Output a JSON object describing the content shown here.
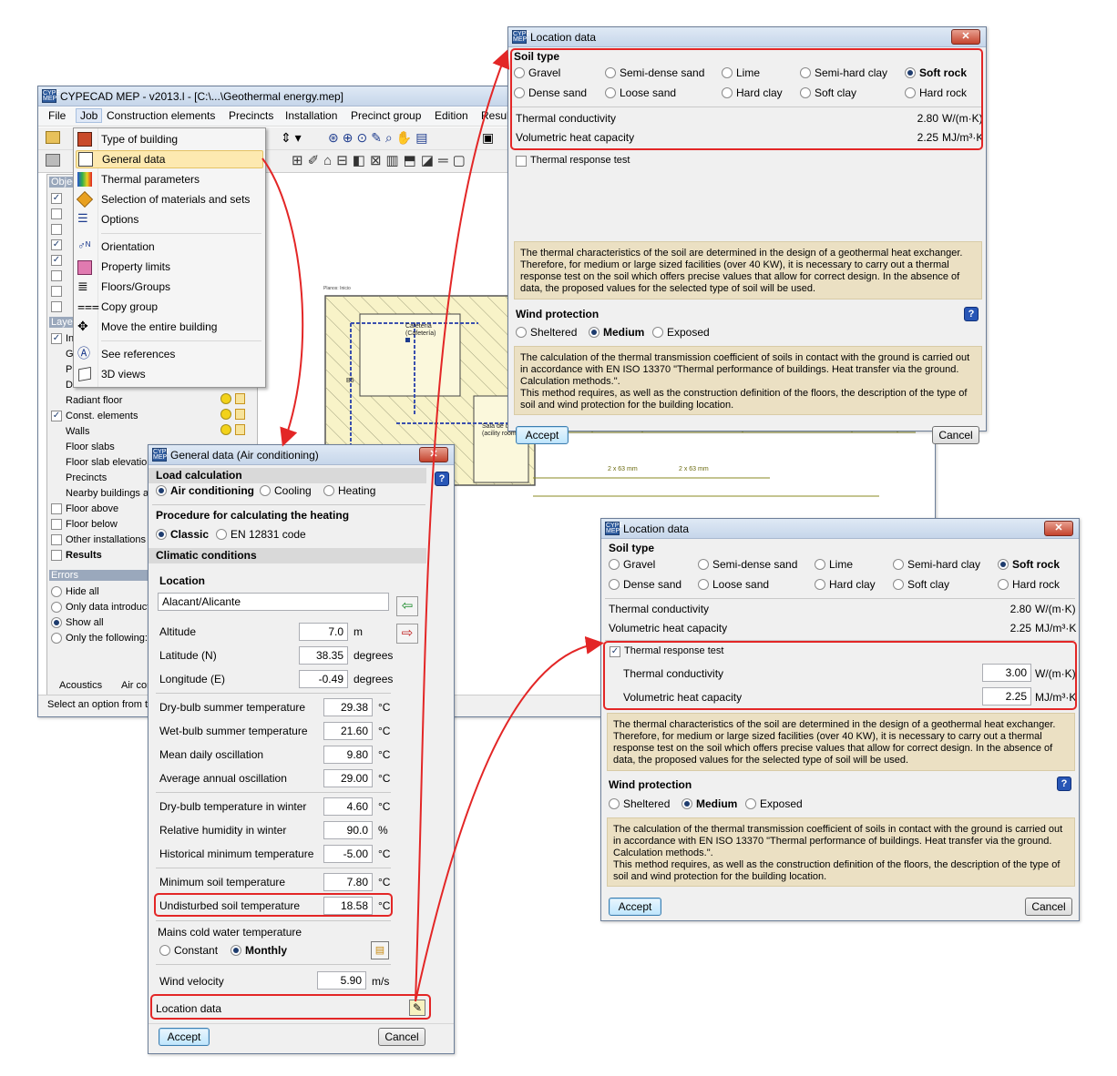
{
  "main_window": {
    "title": "CYPECAD MEP - v2013.l - [C:\\...\\Geothermal energy.mep]",
    "menu": [
      "File",
      "Job",
      "Construction elements",
      "Precincts",
      "Installation",
      "Precinct group",
      "Edition",
      "Resul"
    ],
    "panel": {
      "objects_header": "Objec",
      "layers_header": "Laye",
      "layer_rows": [
        {
          "label": "Ins",
          "checked": true
        },
        {
          "label": "Gr",
          "checked": null
        },
        {
          "label": "Pi",
          "checked": null
        },
        {
          "label": "Ducts",
          "checked": null
        },
        {
          "label": "Radiant floor",
          "checked": null
        },
        {
          "label": "Const. elements",
          "checked": true
        },
        {
          "label": "Walls",
          "checked": null
        },
        {
          "label": "Floor slabs",
          "checked": null
        },
        {
          "label": "Floor slab elevation",
          "checked": null
        },
        {
          "label": "Precincts",
          "checked": null
        },
        {
          "label": "Nearby buildings ar",
          "checked": null
        },
        {
          "label": "Floor above",
          "checked": false
        },
        {
          "label": "Floor below",
          "checked": false
        },
        {
          "label": "Other installations",
          "checked": false
        },
        {
          "label": "Results",
          "checked": false
        }
      ],
      "errors_header": "Errors",
      "error_options": [
        "Hide all",
        "Only data introducti",
        "Show all",
        "Only the following:"
      ],
      "error_selected": 2
    },
    "tabs": [
      "Acoustics",
      "Air con"
    ],
    "status": "Select an option from th",
    "drawing_labels": [
      "Cafetería",
      "(Cafetería)",
      "Sala de ca",
      "(acility room)",
      "B5",
      "2 x 63 mm",
      "2 x 63 mm",
      "Planos: Inicio"
    ]
  },
  "job_menu": {
    "items": [
      "Type of building",
      "General data",
      "Thermal parameters",
      "Selection of materials and sets",
      "Options",
      "Orientation",
      "Property limits",
      "Floors/Groups",
      "Copy group",
      "Move the entire building",
      "See references",
      "3D views"
    ],
    "highlighted": "General data"
  },
  "general_data": {
    "title": "General data (Air conditioning)",
    "load_calculation": {
      "header": "Load calculation",
      "options": [
        "Air conditioning",
        "Cooling",
        "Heating"
      ],
      "selected": "Air conditioning"
    },
    "heating_procedure": {
      "header": "Procedure for calculating the heating",
      "options": [
        "Classic",
        "EN 12831 code"
      ],
      "selected": "Classic"
    },
    "climatic_header": "Climatic conditions",
    "location_label": "Location",
    "location_value": "Alacant/Alicante",
    "geo_fields": [
      {
        "label": "Altitude",
        "value": "7.0",
        "unit": "m"
      },
      {
        "label": "Latitude (N)",
        "value": "38.35",
        "unit": "degrees"
      },
      {
        "label": "Longitude (E)",
        "value": "-0.49",
        "unit": "degrees"
      }
    ],
    "temp_fields": [
      {
        "label": "Dry-bulb summer temperature",
        "value": "29.38",
        "unit": "°C"
      },
      {
        "label": "Wet-bulb summer temperature",
        "value": "21.60",
        "unit": "°C"
      },
      {
        "label": "Mean daily oscillation",
        "value": "9.80",
        "unit": "°C"
      },
      {
        "label": "Average annual oscillation",
        "value": "29.00",
        "unit": "°C"
      },
      {
        "label": "Dry-bulb temperature in winter",
        "value": "4.60",
        "unit": "°C"
      },
      {
        "label": "Relative humidity in winter",
        "value": "90.0",
        "unit": "%"
      },
      {
        "label": "Historical minimum temperature",
        "value": "-5.00",
        "unit": "°C"
      },
      {
        "label": "Minimum soil temperature",
        "value": "7.80",
        "unit": "°C"
      },
      {
        "label": "Undisturbed soil temperature",
        "value": "18.58",
        "unit": "°C"
      }
    ],
    "mains_water": {
      "header": "Mains cold water temperature",
      "options": [
        "Constant",
        "Monthly"
      ],
      "selected": "Monthly"
    },
    "wind_velocity": {
      "label": "Wind velocity",
      "value": "5.90",
      "unit": "m/s"
    },
    "location_data_label": "Location data",
    "accept": "Accept",
    "cancel": "Cancel"
  },
  "location_top": {
    "title": "Location data",
    "soil_type_header": "Soil type",
    "soil_options": [
      "Gravel",
      "Semi-dense sand",
      "Lime",
      "Semi-hard clay",
      "Soft rock",
      "Dense sand",
      "Loose sand",
      "Hard clay",
      "Soft clay",
      "Hard rock"
    ],
    "soil_selected": "Soft rock",
    "thermal_conductivity": {
      "label": "Thermal conductivity",
      "value": "2.80",
      "unit": "W/(m·K)"
    },
    "volumetric_heat": {
      "label": "Volumetric heat capacity",
      "value": "2.25",
      "unit": "MJ/m³·K"
    },
    "thermal_response_test": {
      "label": "Thermal response test",
      "checked": false
    },
    "soil_info": "The thermal characteristics of the soil are determined in the design of a geothermal heat exchanger. Therefore, for medium or large sized facilities (over 40 KW), it is necessary to carry out a thermal response test on the soil which offers precise values that allow for correct design. In the absence of data, the proposed values for the selected type of soil will be used.",
    "wind_header": "Wind protection",
    "wind_options": [
      "Sheltered",
      "Medium",
      "Exposed"
    ],
    "wind_selected": "Medium",
    "wind_info": "The calculation of the thermal transmission coefficient of soils in contact with the ground is carried out in accordance with EN ISO 13370 \"Thermal performance of buildings. Heat transfer via the ground. Calculation methods.\".\nThis method requires, as well as the construction definition of the floors, the description of the type of soil and wind protection for the building location.",
    "accept": "Accept",
    "cancel": "Cancel"
  },
  "location_bottom": {
    "title": "Location data",
    "soil_type_header": "Soil type",
    "soil_options": [
      "Gravel",
      "Semi-dense sand",
      "Lime",
      "Semi-hard clay",
      "Soft rock",
      "Dense sand",
      "Loose sand",
      "Hard clay",
      "Soft clay",
      "Hard rock"
    ],
    "soil_selected": "Soft rock",
    "thermal_conductivity": {
      "label": "Thermal conductivity",
      "value": "2.80",
      "unit": "W/(m·K)"
    },
    "volumetric_heat": {
      "label": "Volumetric heat capacity",
      "value": "2.25",
      "unit": "MJ/m³·K"
    },
    "thermal_response_test": {
      "label": "Thermal response test",
      "checked": true
    },
    "trt_conductivity": {
      "label": "Thermal conductivity",
      "value": "3.00",
      "unit": "W/(m·K)"
    },
    "trt_volumetric": {
      "label": "Volumetric heat capacity",
      "value": "2.25",
      "unit": "MJ/m³·K"
    },
    "soil_info": "The thermal characteristics of the soil are determined in the design of a geothermal heat exchanger. Therefore, for medium or large sized facilities (over 40 KW), it is necessary to carry out a thermal response test on the soil which offers precise values that allow for correct design. In the absence of data, the proposed values for the selected type of soil will be used.",
    "wind_header": "Wind protection",
    "wind_options": [
      "Sheltered",
      "Medium",
      "Exposed"
    ],
    "wind_selected": "Medium",
    "wind_info": "The calculation of the thermal transmission coefficient of soils in contact with the ground is carried out in accordance with EN ISO 13370 \"Thermal performance of buildings. Heat transfer via the ground. Calculation methods.\".\nThis method requires, as well as the construction definition of the floors, the description of the type of soil and wind protection for the building location.",
    "accept": "Accept",
    "cancel": "Cancel"
  },
  "colors": {
    "highlight_red": "#e32626",
    "info_bg": "#ebe0c3",
    "menu_highlight": "#fde9b0",
    "cad_yellow": "#f8f3c8"
  }
}
